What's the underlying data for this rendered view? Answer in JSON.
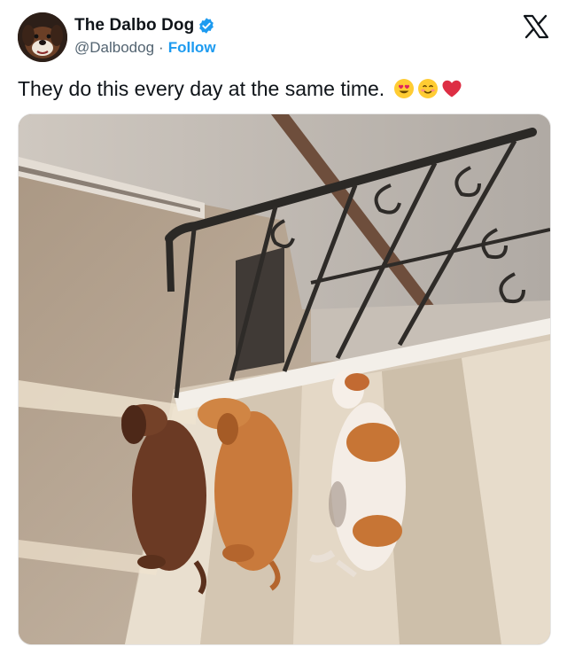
{
  "user": {
    "display_name": "The Dalbo Dog",
    "handle": "@Dalbodog",
    "separator": "·",
    "follow_label": "Follow",
    "verified": true
  },
  "tweet": {
    "text": "They do this every day at the same time.",
    "emojis": [
      "heart-eyes-emoji",
      "smiling-face-emoji",
      "red-heart-emoji"
    ]
  },
  "media": {
    "description_icon": "photo-of-three-dachshunds-on-stairs"
  },
  "colors": {
    "link_blue": "#1d9bf0",
    "verified_blue": "#1d9bf0",
    "secondary_text": "#536471"
  }
}
